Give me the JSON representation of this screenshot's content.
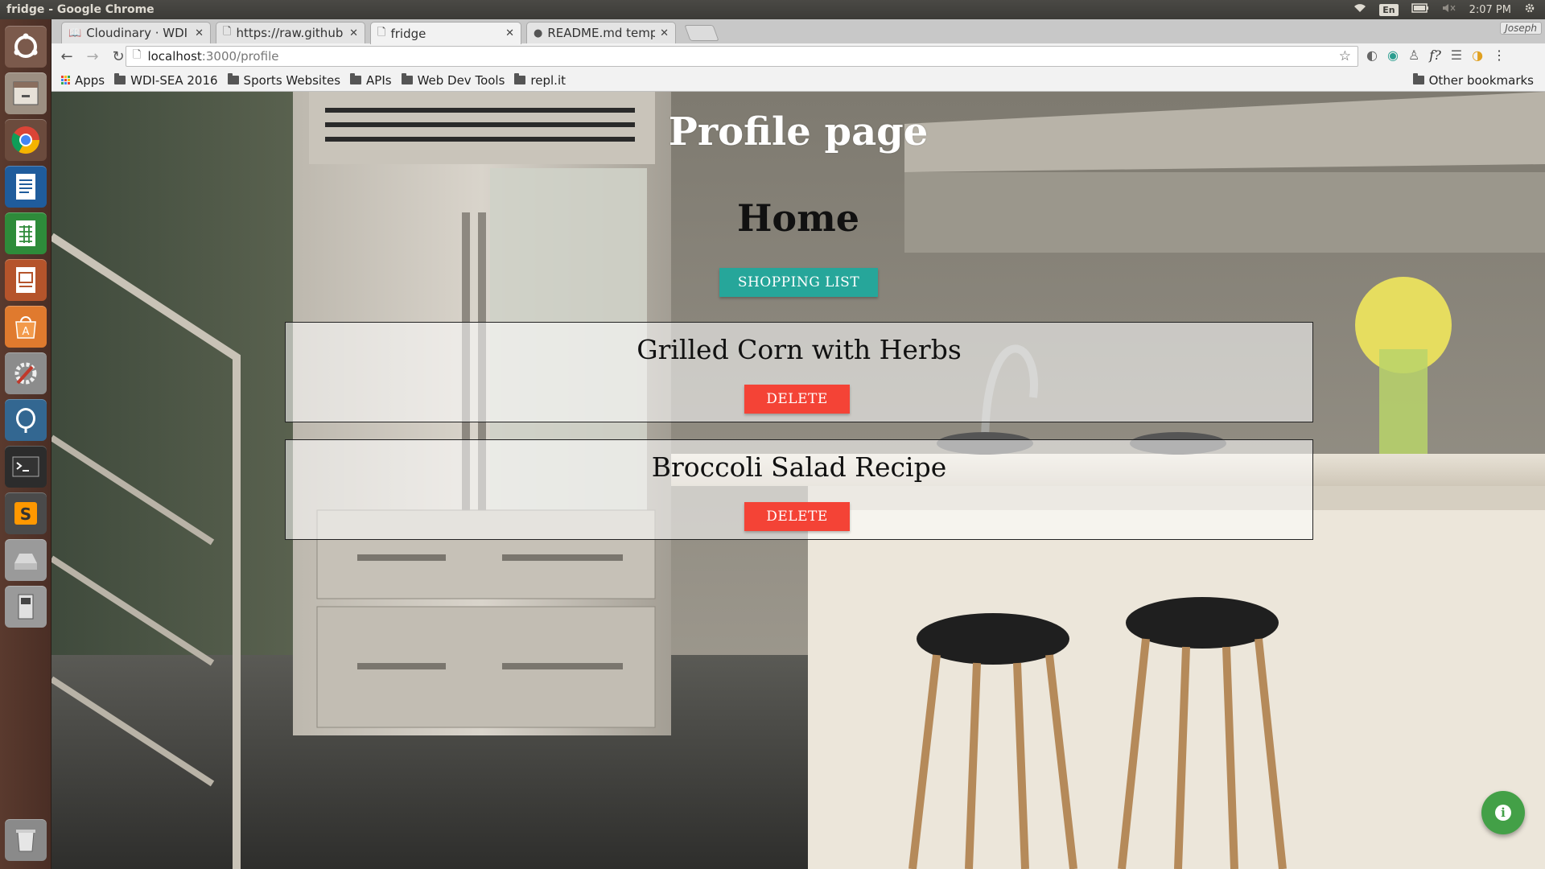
{
  "panel": {
    "window_title": "fridge - Google Chrome",
    "keyboard_layout": "En",
    "clock": "2:07 PM"
  },
  "launcher": {
    "items": [
      "ubuntu-dash-icon",
      "files-icon",
      "chrome-icon",
      "writer-icon",
      "calc-icon",
      "impress-icon",
      "software-center-icon",
      "system-settings-icon",
      "pgadmin-icon",
      "terminal-icon",
      "sublime-text-icon",
      "drive-icon",
      "removable-device-icon",
      "trash-icon"
    ]
  },
  "browser": {
    "tabs": [
      {
        "label": "Cloudinary · WDI No",
        "icon": "book-icon"
      },
      {
        "label": "https://raw.github",
        "icon": "page-icon"
      },
      {
        "label": "fridge",
        "icon": "page-icon",
        "active": true
      },
      {
        "label": "README.md templ",
        "icon": "github-icon"
      }
    ],
    "profile_name": "Joseph",
    "url_host": "localhost",
    "url_path": ":3000/profile",
    "bookmarks": [
      "Apps",
      "WDI-SEA 2016",
      "Sports Websites",
      "APIs",
      "Web Dev Tools",
      "repl.it"
    ],
    "other_bookmarks": "Other bookmarks"
  },
  "page": {
    "title": "Profile page",
    "home_link": "Home",
    "shopping_list_button": "SHOPPING LIST",
    "recipes": [
      {
        "name": "Grilled Corn with Herbs",
        "delete_label": "DELETE"
      },
      {
        "name": "Broccoli Salad Recipe",
        "delete_label": "DELETE"
      }
    ],
    "fab_icon": "info-icon",
    "colors": {
      "teal": "#26a69a",
      "red": "#f44336",
      "green": "#43a047"
    }
  }
}
